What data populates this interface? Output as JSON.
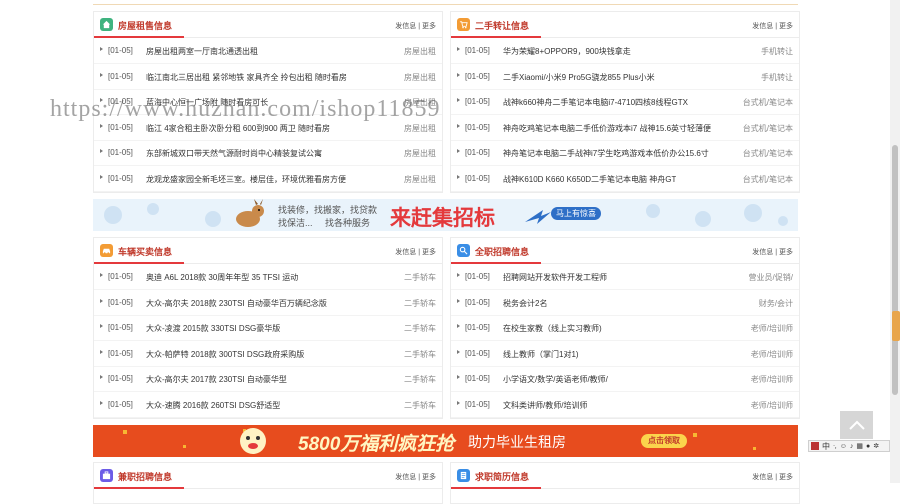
{
  "panels": {
    "house": {
      "title": "房屋租售信息",
      "post": "发信息",
      "more": "更多",
      "rows": [
        {
          "date": "[01-05]",
          "title": "房屋出租两室一厅南北通透出租",
          "cat": "房屋出租"
        },
        {
          "date": "[01-05]",
          "title": "临江南北三居出租 紧邻地铁 家具齐全 拎包出租 随时看房",
          "cat": "房屋出租"
        },
        {
          "date": "[01-05]",
          "title": "蓝海中心恒一广场附 随时看房可长",
          "cat": "房屋出租"
        },
        {
          "date": "[01-05]",
          "title": "临江 4家合租主卧次卧分租 600到900 两卫 随时看房",
          "cat": "房屋出租"
        },
        {
          "date": "[01-05]",
          "title": "东部新城双口带天然气源耐时尚中心精装复试公寓",
          "cat": "房屋出租"
        },
        {
          "date": "[01-05]",
          "title": "龙观龙盛家园全新毛坯三室。楼层佳，环境优雅看房方便",
          "cat": "房屋出租"
        }
      ]
    },
    "secondhand": {
      "title": "二手转让信息",
      "post": "发信息",
      "more": "更多",
      "rows": [
        {
          "date": "[01-05]",
          "title": "华为荣耀8+OPPOR9，900块钱拿走",
          "cat": "手机转让"
        },
        {
          "date": "[01-05]",
          "title": "二手Xiaomi/小米9 Pro5G骁龙855 Plus小米",
          "cat": "手机转让"
        },
        {
          "date": "[01-05]",
          "title": "战神k660神舟二手笔记本电脑i7-4710四核8线程GTX",
          "cat": "台式机/笔记本"
        },
        {
          "date": "[01-05]",
          "title": "神舟吃鸡笔记本电脑二手低价游戏本i7 战神15.6英寸轻薄便",
          "cat": "台式机/笔记本"
        },
        {
          "date": "[01-05]",
          "title": "神舟笔记本电脑二手战神i7学生吃鸡游戏本低价办公15.6寸",
          "cat": "台式机/笔记本"
        },
        {
          "date": "[01-05]",
          "title": "战神K610D K660 K650D二手笔记本电脑 神舟GT",
          "cat": "台式机/笔记本"
        }
      ]
    },
    "car": {
      "title": "车辆买卖信息",
      "post": "发信息",
      "more": "更多",
      "rows": [
        {
          "date": "[01-05]",
          "title": "奥迪 A6L 2018款 30周年年型 35 TFSI 运动",
          "cat": "二手轿车"
        },
        {
          "date": "[01-05]",
          "title": "大众-高尔夫 2018款 230TSI 自动豪华百万辆纪念版",
          "cat": "二手轿车"
        },
        {
          "date": "[01-05]",
          "title": "大众-凌渡 2015款 330TSI DSG豪华版",
          "cat": "二手轿车"
        },
        {
          "date": "[01-05]",
          "title": "大众-帕萨特 2018款 300TSI DSG政府采购版",
          "cat": "二手轿车"
        },
        {
          "date": "[01-05]",
          "title": "大众-高尔夫 2017款 230TSI 自动豪华型",
          "cat": "二手轿车"
        },
        {
          "date": "[01-05]",
          "title": "大众-速腾 2016款 260TSI DSG舒适型",
          "cat": "二手轿车"
        }
      ]
    },
    "job": {
      "title": "全职招聘信息",
      "post": "发信息",
      "more": "更多",
      "rows": [
        {
          "date": "[01-05]",
          "title": "招聘网站开发软件开发工程师",
          "cat": "营业员/促销/"
        },
        {
          "date": "[01-05]",
          "title": "税务会计2名",
          "cat": "财务/会计"
        },
        {
          "date": "[01-05]",
          "title": "在校生家教（线上实习教师)",
          "cat": "老师/培训师"
        },
        {
          "date": "[01-05]",
          "title": "线上教师（掌门1对1)",
          "cat": "老师/培训师"
        },
        {
          "date": "[01-05]",
          "title": "小学语文/数学/英语老师/教师/",
          "cat": "老师/培训师"
        },
        {
          "date": "[01-05]",
          "title": "文科类讲师/教师/培训师",
          "cat": "老师/培训师"
        }
      ]
    },
    "parttime": {
      "title": "兼职招聘信息",
      "post": "发信息",
      "more": "更多"
    },
    "resume": {
      "title": "求职简历信息",
      "post": "发信息",
      "more": "更多"
    }
  },
  "banner1": {
    "line1": "找装修，找搬家，找贷款",
    "line2": "找保洁...     找各种服务",
    "big": "来赶集招标",
    "badge": "马上有惊喜"
  },
  "banner2": {
    "big": "5800万福利疯狂抢",
    "sub": "助力毕业生租房",
    "button": "点击领取"
  },
  "watermark": "https://www.huzhan.com/ishop11859",
  "ime": {
    "label": "中"
  },
  "colors": {
    "accent": "#e4393c",
    "house_icon": "#3fb37f",
    "secondhand_icon": "#f39c35",
    "car_icon": "#f39c35",
    "job_icon": "#3a8ee6",
    "parttime_icon": "#6c5ce7",
    "resume_icon": "#3a8ee6"
  }
}
